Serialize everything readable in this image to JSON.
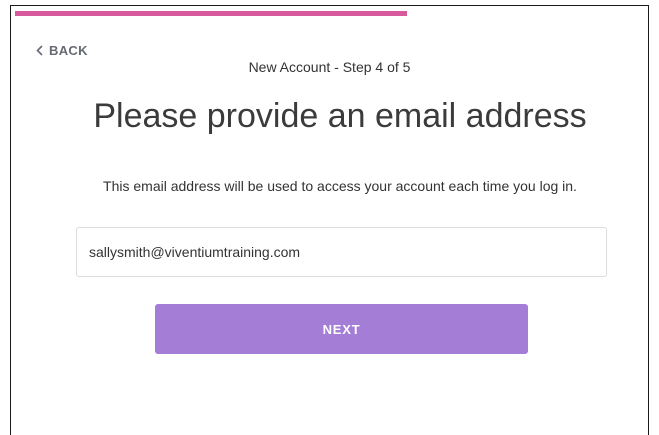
{
  "header": {
    "back_label": "BACK",
    "step_label": "New Account - Step 4 of 5"
  },
  "progress": {
    "current_step": 4,
    "total_steps": 5
  },
  "main": {
    "title": "Please provide an email address",
    "subtitle": "This email address will be used to access your account each time you log in.",
    "email_value": "sallysmith@viventiumtraining.com",
    "next_label": "NEXT"
  },
  "colors": {
    "progress": "#d9599d",
    "button": "#a47dd6",
    "back_text": "#666a73"
  },
  "icons": {
    "back": "chevron-left-icon"
  }
}
